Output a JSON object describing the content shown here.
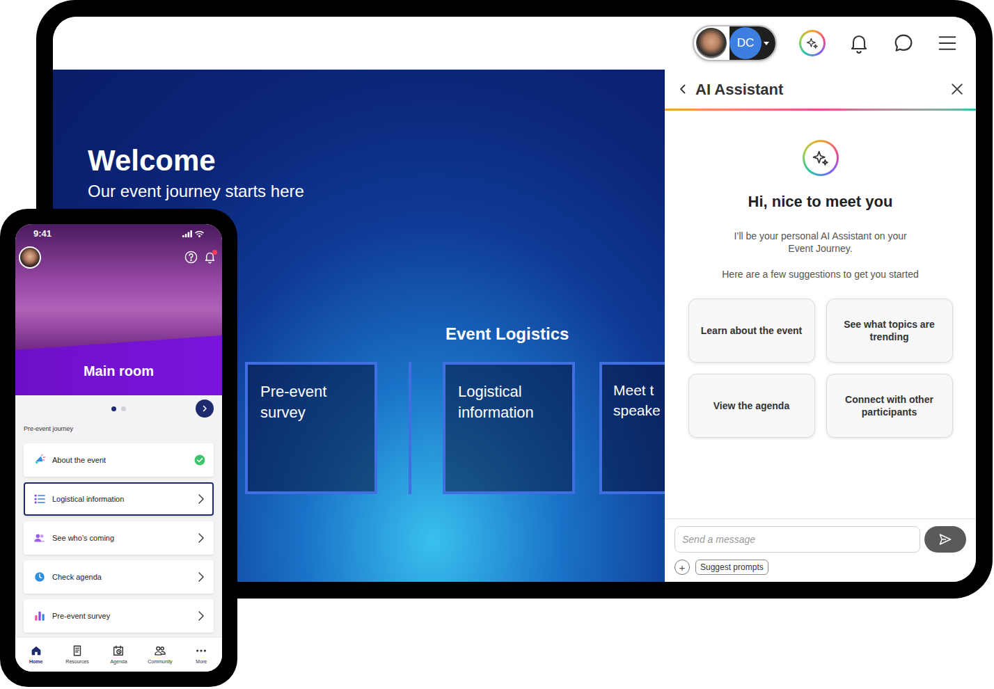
{
  "desktop": {
    "topbar": {
      "avatar_initials": "DC"
    },
    "hero": {
      "title": "Welcome",
      "subtitle": "Our event journey starts here",
      "section_title": "Event Logistics",
      "cards": [
        {
          "label": "Pre-event survey"
        },
        {
          "label": "Logistical information"
        },
        {
          "label": "Meet t speake"
        }
      ]
    },
    "assistant": {
      "title": "AI Assistant",
      "greeting": "Hi, nice to meet you",
      "intro": "I’ll be your personal AI Assistant on your Event Journey.",
      "suggestions_label": "Here are a few suggestions to get you started",
      "suggestions": [
        "Learn about the event",
        "See what topics are trending",
        "View the agenda",
        "Connect with other participants"
      ],
      "input": {
        "placeholder": "Send a message"
      },
      "add_button": "+",
      "suggest_button": "Suggest prompts"
    }
  },
  "phone": {
    "status_time": "9:41",
    "notification": true,
    "room_title": "Main room",
    "pages": [
      {
        "selected": true
      },
      {
        "selected": false
      }
    ],
    "section_label": "Pre-event journey",
    "items": [
      {
        "label": "About the event",
        "kind": "megaphone",
        "done": true,
        "selected": false
      },
      {
        "label": "Logistical information",
        "kind": "list",
        "done": false,
        "selected": true
      },
      {
        "label": "See who’s coming",
        "kind": "people",
        "done": false,
        "selected": false
      },
      {
        "label": "Check agenda",
        "kind": "clock",
        "done": false,
        "selected": false
      },
      {
        "label": "Pre-event survey",
        "kind": "chart",
        "done": false,
        "selected": false
      }
    ],
    "nav": [
      {
        "label": "Home",
        "kind": "home",
        "selected": true
      },
      {
        "label": "Resources",
        "kind": "resources",
        "selected": false
      },
      {
        "label": "Agenda",
        "kind": "agenda",
        "selected": false
      },
      {
        "label": "Community",
        "kind": "community",
        "selected": false
      },
      {
        "label": "More",
        "kind": "more",
        "selected": false
      }
    ]
  }
}
